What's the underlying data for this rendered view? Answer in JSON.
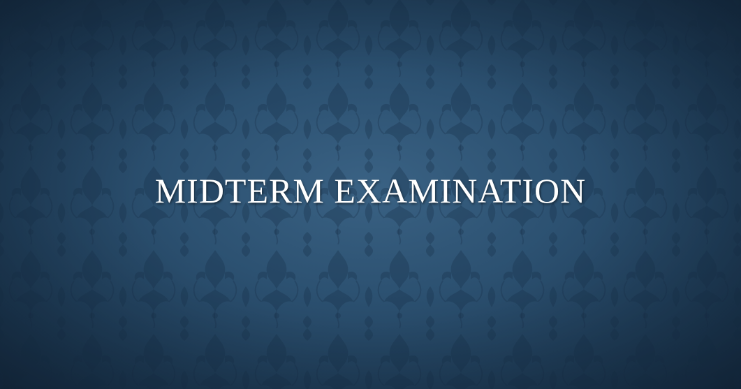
{
  "slide": {
    "title": "MIDTERM EXAMINATION"
  },
  "background": {
    "pattern": "damask-pattern",
    "base_color": "#2c5171",
    "center_color": "#3a6284",
    "edge_color": "#152c44",
    "title_color": "#ffffff"
  }
}
